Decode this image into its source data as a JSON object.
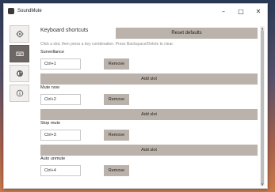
{
  "window": {
    "title": "SoundMute",
    "controls": {
      "minimize": "–",
      "maximize": "□",
      "close": "✕"
    }
  },
  "sidebar": {
    "items": [
      {
        "icon": "gear-icon",
        "active": false
      },
      {
        "icon": "keyboard-icon",
        "active": true
      },
      {
        "icon": "globe-icon",
        "active": false
      },
      {
        "icon": "info-icon",
        "active": false
      }
    ]
  },
  "page": {
    "title": "Keyboard shortcuts",
    "reset_label": "Reset defaults",
    "hint": "Click a slot, then press a key combination. Press Backspace/Delete to clear."
  },
  "shortcuts": [
    {
      "name": "Surveillance",
      "slot_value": "Ctrl+1",
      "remove_label": "Remove",
      "add_label": "Add slot"
    },
    {
      "name": "Mute now",
      "slot_value": "Ctrl+2",
      "remove_label": "Remove",
      "add_label": "Add slot"
    },
    {
      "name": "Stop mute",
      "slot_value": "Ctrl+3",
      "remove_label": "Remove",
      "add_label": "Add slot"
    },
    {
      "name": "Auto unmute",
      "slot_value": "Ctrl+4",
      "remove_label": "Remove"
    }
  ],
  "scrollbar": {
    "up": "▲",
    "down": "▼"
  },
  "colors": {
    "button_bg": "#bbb3ab",
    "sidebar_active": "#6c6764",
    "hint_text": "#8a8a8a"
  }
}
